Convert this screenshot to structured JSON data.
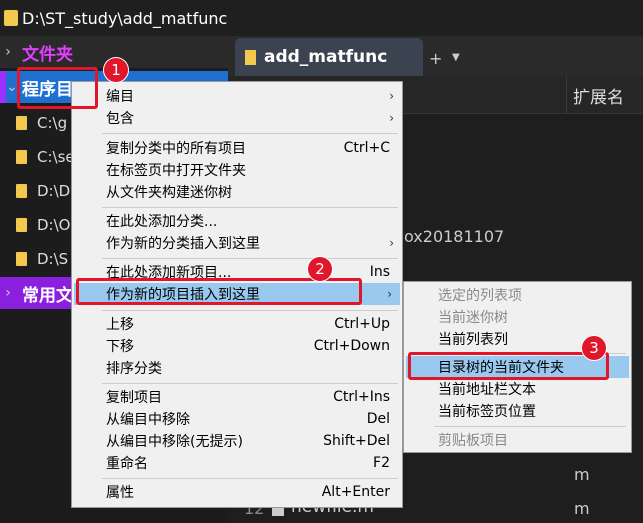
{
  "window": {
    "title": "D:\\ST_study\\add_matfunc"
  },
  "tree": {
    "nodes": [
      {
        "label": "文件夹",
        "chev": "›"
      },
      {
        "label": "程序目",
        "chev": "⌄"
      },
      {
        "label": "常用文",
        "chev": "›"
      }
    ],
    "leaves": [
      "C:\\g",
      "C:\\se",
      "D:\\D",
      "D:\\O",
      "D:\\S"
    ]
  },
  "tabs": {
    "active": "add_matfunc",
    "add": "+",
    "menu": "▼"
  },
  "list": {
    "ext_header": "扩展名",
    "fragment": "ox20181107",
    "ext_values": [
      "m",
      "m"
    ],
    "last_row": {
      "num": "12",
      "name": "newfile.m"
    }
  },
  "menu1": {
    "items": [
      {
        "label": "编目",
        "shortcut": "",
        "submenu": true
      },
      {
        "label": "包含",
        "shortcut": "",
        "submenu": true
      },
      {
        "label": "复制分类中的所有项目",
        "shortcut": "Ctrl+C"
      },
      {
        "label": "在标签页中打开文件夹",
        "shortcut": ""
      },
      {
        "label": "从文件夹构建迷你树",
        "shortcut": ""
      },
      {
        "label": "在此处添加分类...",
        "shortcut": ""
      },
      {
        "label": "作为新的分类插入到这里",
        "shortcut": "",
        "submenu": true
      },
      {
        "label": "在此处添加新项目...",
        "shortcut": "Ins"
      },
      {
        "label": "作为新的项目插入到这里",
        "shortcut": "",
        "submenu": true
      },
      {
        "label": "上移",
        "shortcut": "Ctrl+Up"
      },
      {
        "label": "下移",
        "shortcut": "Ctrl+Down"
      },
      {
        "label": "排序分类",
        "shortcut": ""
      },
      {
        "label": "复制项目",
        "shortcut": "Ctrl+Ins"
      },
      {
        "label": "从编目中移除",
        "shortcut": "Del"
      },
      {
        "label": "从编目中移除(无提示)",
        "shortcut": "Shift+Del"
      },
      {
        "label": "重命名",
        "shortcut": "F2"
      },
      {
        "label": "属性",
        "shortcut": "Alt+Enter"
      }
    ]
  },
  "menu2": {
    "items": [
      {
        "label": "选定的列表项",
        "disabled": true
      },
      {
        "label": "当前迷你树",
        "disabled": true
      },
      {
        "label": "当前列表列",
        "disabled": false
      },
      {
        "label": "目录树的当前文件夹",
        "disabled": false
      },
      {
        "label": "当前地址栏文本",
        "disabled": false
      },
      {
        "label": "当前标签页位置",
        "disabled": false
      },
      {
        "label": "剪贴板项目",
        "disabled": true
      }
    ]
  },
  "badges": [
    "1",
    "2",
    "3"
  ],
  "colors": {
    "accent_red": "#e0162b",
    "folder": "#f2c94c",
    "highlight": "#99c9ef",
    "tree_sel": "#1f6fd1",
    "purple": "#9b30ff"
  }
}
